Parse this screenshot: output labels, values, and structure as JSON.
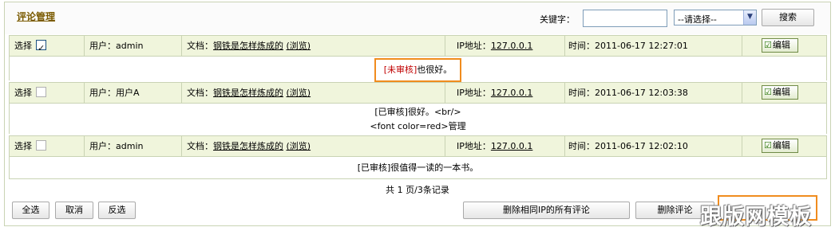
{
  "header": {
    "title": "评论管理",
    "keyword_label": "关键字：",
    "keyword_value": "",
    "select_value": "--请选择--",
    "search_label": "搜索"
  },
  "records": [
    {
      "select_label": "选择",
      "checked": true,
      "user": "用户：admin",
      "doc_label": "文档：",
      "doc_title": "钢铁是怎样炼成的",
      "browse": "(浏览)",
      "ip_label": "IP地址：",
      "ip": "127.0.0.1",
      "time": "时间：2011-06-17 12:27:01",
      "edit_label": "编辑",
      "status": "[未审核]",
      "content": "也很好。"
    },
    {
      "select_label": "选择",
      "checked": false,
      "user": "用户：用户A",
      "doc_label": "文档：",
      "doc_title": "钢铁是怎样炼成的",
      "browse": "(浏览)",
      "ip_label": "IP地址：",
      "ip": "127.0.0.1",
      "time": "时间：2011-06-17 12:03:38",
      "edit_label": "编辑",
      "content_line1": "[已审核]很好。<br/>",
      "content_line2": "<font color=red>管理"
    },
    {
      "select_label": "选择",
      "checked": false,
      "user": "用户：admin",
      "doc_label": "文档：",
      "doc_title": "钢铁是怎样炼成的",
      "browse": "(浏览)",
      "ip_label": "IP地址：",
      "ip": "127.0.0.1",
      "time": "时间：2011-06-17 12:02:10",
      "edit_label": "编辑",
      "content": "[已审核]很值得一读的一本书。"
    }
  ],
  "pager": "共 1 页/3条记录",
  "footer": {
    "select_all": "全选",
    "cancel": "取消",
    "invert": "反选",
    "delete_same_ip": "删除相同IP的所有评论",
    "delete_comment": "删除评论"
  },
  "watermark": "跟版网模板",
  "colors": {
    "accent_border": "#f08c1e",
    "header_bg": "#f0f5dc",
    "pending_red": "#c00000"
  }
}
